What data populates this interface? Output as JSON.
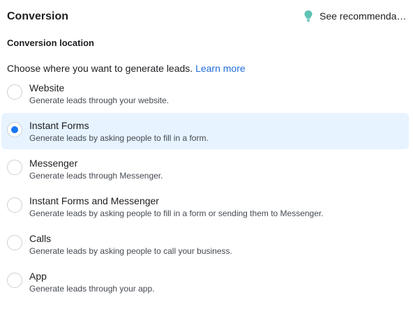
{
  "header": {
    "title": "Conversion",
    "recommendations_label": "See recommendations",
    "recommendations_icon": "lightbulb-icon"
  },
  "section": {
    "label": "Conversion location",
    "helper_text": "Choose where you want to generate leads.",
    "learn_more": "Learn more"
  },
  "options": [
    {
      "title": "Website",
      "description": "Generate leads through your website.",
      "selected": false
    },
    {
      "title": "Instant Forms",
      "description": "Generate leads by asking people to fill in a form.",
      "selected": true
    },
    {
      "title": "Messenger",
      "description": "Generate leads through Messenger.",
      "selected": false
    },
    {
      "title": "Instant Forms and Messenger",
      "description": "Generate leads by asking people to fill in a form or sending them to Messenger.",
      "selected": false
    },
    {
      "title": "Calls",
      "description": "Generate leads by asking people to call your business.",
      "selected": false
    },
    {
      "title": "App",
      "description": "Generate leads through your app.",
      "selected": false
    }
  ],
  "colors": {
    "accent": "#1877f2",
    "link": "#216fdb",
    "selected_bg": "#e7f3ff",
    "bulb": "#5ec2b4"
  }
}
